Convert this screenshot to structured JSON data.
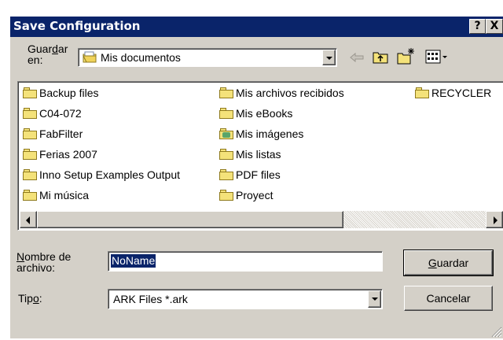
{
  "window": {
    "title": "Save Configuration",
    "help_btn": "?",
    "close_btn": "X"
  },
  "save_in": {
    "label_line1_pre": "Guar",
    "label_line1_u": "d",
    "label_line1_post": "ar",
    "label_line2": "en:",
    "value": "Mis documentos"
  },
  "files": [
    {
      "name": "Backup files",
      "icon": "folder-icon"
    },
    {
      "name": "C04-072",
      "icon": "folder-icon"
    },
    {
      "name": "FabFilter",
      "icon": "folder-icon"
    },
    {
      "name": "Ferias 2007",
      "icon": "folder-icon"
    },
    {
      "name": "Inno Setup Examples Output",
      "icon": "folder-icon"
    },
    {
      "name": "Mi música",
      "icon": "folder-icon"
    },
    {
      "name": "Mis archivos recibidos",
      "icon": "folder-icon"
    },
    {
      "name": "Mis eBooks",
      "icon": "folder-icon"
    },
    {
      "name": "Mis imágenes",
      "icon": "pictures-folder-icon"
    },
    {
      "name": "Mis listas",
      "icon": "folder-icon"
    },
    {
      "name": "PDF files",
      "icon": "folder-icon"
    },
    {
      "name": "Proyect",
      "icon": "folder-icon"
    },
    {
      "name": "RECYCLER",
      "icon": "folder-icon"
    }
  ],
  "filename": {
    "label_line1_u": "N",
    "label_line1_post": "ombre de",
    "label_line2": "archivo:",
    "value": "NoName"
  },
  "filetype": {
    "label_pre": "Tip",
    "label_u": "o",
    "label_post": ":",
    "value": "ARK Files *.ark"
  },
  "buttons": {
    "save_u": "G",
    "save_rest": "uardar",
    "cancel": "Cancelar"
  },
  "colors": {
    "titlebar": "#0a246a",
    "face": "#d4d0c8",
    "selection": "#0a246a"
  }
}
